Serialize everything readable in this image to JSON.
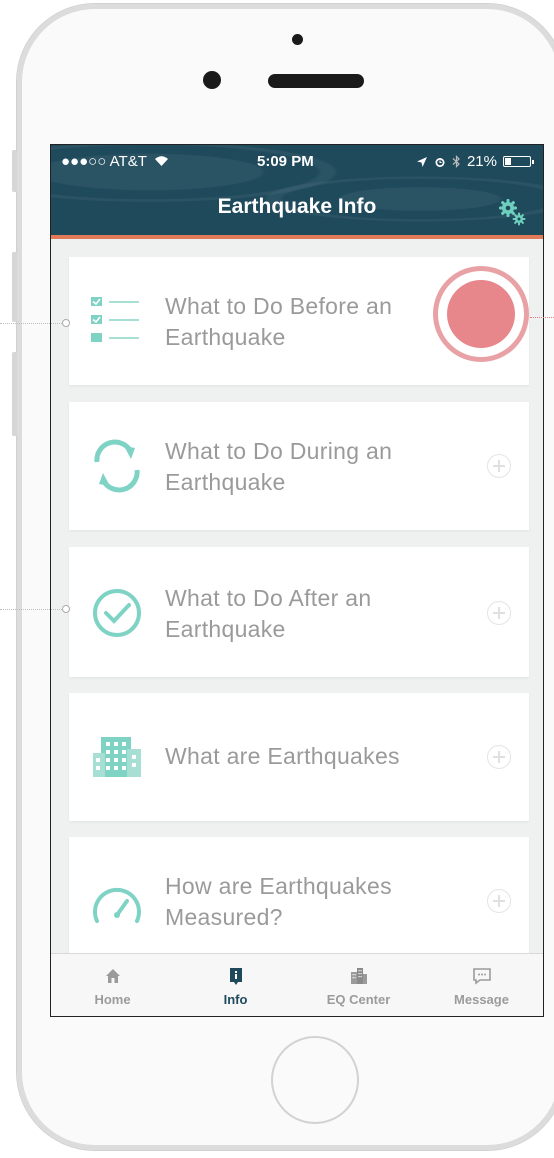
{
  "status_bar": {
    "carrier": "●●●○○ AT&T",
    "time": "5:09 PM",
    "battery": "21%"
  },
  "nav": {
    "title": "Earthquake Info",
    "settings_icon": "gears-icon"
  },
  "cards": [
    {
      "icon": "checklist-icon",
      "label": "What to Do Before an Earthquake"
    },
    {
      "icon": "refresh-icon",
      "label": "What to Do During an Earthquake"
    },
    {
      "icon": "check-circle-icon",
      "label": "What to Do After an Earthquake"
    },
    {
      "icon": "building-icon",
      "label": "What are Earthquakes"
    },
    {
      "icon": "gauge-icon",
      "label": "How are Earthquakes Measured?"
    }
  ],
  "tabs": [
    {
      "label": "Home",
      "icon": "home-icon",
      "active": false
    },
    {
      "label": "Info",
      "icon": "info-icon",
      "active": true
    },
    {
      "label": "EQ Center",
      "icon": "city-icon",
      "active": false
    },
    {
      "label": "Message",
      "icon": "message-icon",
      "active": false
    }
  ],
  "colors": {
    "nav_bg": "#1f4a5c",
    "accent_line": "#e07a57",
    "icon_teal": "#7fd3c4",
    "tap_indicator": "#e57d82"
  }
}
